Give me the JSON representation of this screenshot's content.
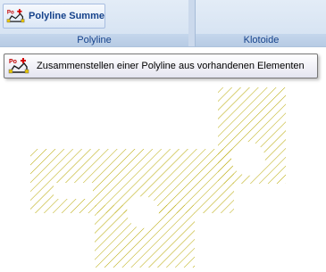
{
  "ribbon": {
    "button": {
      "label": "Polyline Summe",
      "icon": "polyline-sum-icon"
    },
    "groups": [
      {
        "label": "Polyline"
      },
      {
        "label": "Klotoide"
      }
    ]
  },
  "tooltip": {
    "text": "Zusammenstellen einer Polyline aus vorhandenen Elementen",
    "icon": "polyline-sum-icon"
  },
  "drawing": {
    "hatch_color": "#b8a800",
    "description_icon": "hatched-region"
  }
}
